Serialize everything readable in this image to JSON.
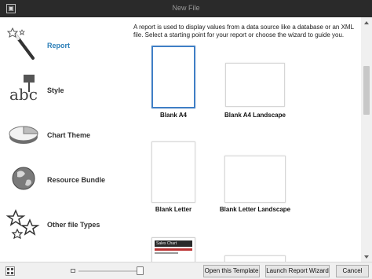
{
  "window": {
    "title": "New File"
  },
  "sidebar": {
    "items": [
      {
        "label": "Report",
        "icon": "wand-icon",
        "selected": true
      },
      {
        "label": "Style",
        "icon": "abc-style-icon",
        "selected": false
      },
      {
        "label": "Chart Theme",
        "icon": "pie-chart-icon",
        "selected": false
      },
      {
        "label": "Resource Bundle",
        "icon": "globe-icon",
        "selected": false
      },
      {
        "label": "Other file Types",
        "icon": "stars-icon",
        "selected": false
      }
    ]
  },
  "main": {
    "description": "A report is used to display values from a data source like a database or an XML file. Select a starting point for your report or choose the wizard to guide you.",
    "templates": [
      {
        "label": "Blank A4",
        "selected": true
      },
      {
        "label": "Blank A4 Landscape",
        "selected": false
      },
      {
        "label": "Blank Letter",
        "selected": false
      },
      {
        "label": "Blank Letter Landscape",
        "selected": false
      }
    ],
    "partial_thumb_text": "Sales Chart"
  },
  "footer": {
    "open_template": "Open this Template",
    "launch_wizard": "Launch Report Wizard",
    "cancel": "Cancel"
  },
  "colors": {
    "accent": "#3f7fc6",
    "selected_text": "#2c7fb8",
    "titlebar": "#2a2a2a"
  }
}
